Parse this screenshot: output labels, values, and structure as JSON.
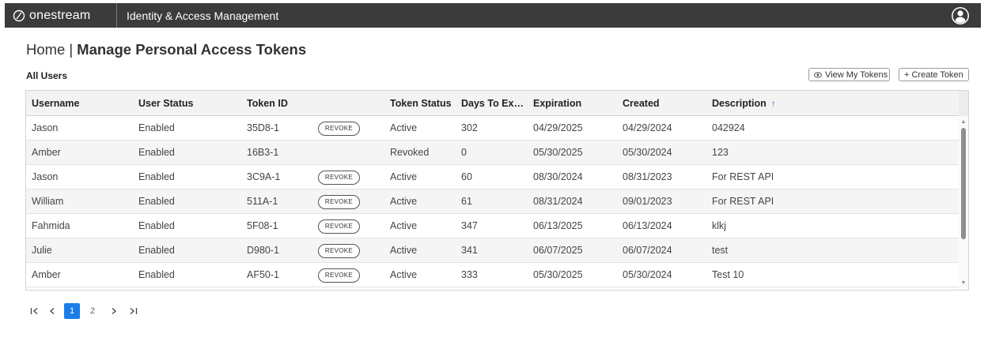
{
  "header": {
    "brand": "onestream",
    "app_title": "Identity & Access Management",
    "brand_icon": "onestream-logo-icon",
    "user_icon": "user-avatar-icon"
  },
  "page": {
    "breadcrumb_home": "Home",
    "breadcrumb_sep": "|",
    "breadcrumb_current": "Manage Personal Access Tokens",
    "section_title": "All Users"
  },
  "toolbar": {
    "view_my_tokens": "View My Tokens",
    "create_token": "+ Create Token"
  },
  "table": {
    "columns": [
      "Username",
      "User Status",
      "Token ID",
      "Token Status",
      "Days To Ex…",
      "Expiration",
      "Created",
      "Description"
    ],
    "sort_indicator": "↑",
    "revoke_label": "REVOKE",
    "rows": [
      {
        "username": "Jason",
        "user_status": "Enabled",
        "token_id": "35D8-1",
        "revoke": true,
        "token_status": "Active",
        "days": "302",
        "expiration": "04/29/2025",
        "created": "04/29/2024",
        "description": "042924"
      },
      {
        "username": "Amber",
        "user_status": "Enabled",
        "token_id": "16B3-1",
        "revoke": false,
        "token_status": "Revoked",
        "days": "0",
        "expiration": "05/30/2025",
        "created": "05/30/2024",
        "description": "123"
      },
      {
        "username": "Jason",
        "user_status": "Enabled",
        "token_id": "3C9A-1",
        "revoke": true,
        "token_status": "Active",
        "days": "60",
        "expiration": "08/30/2024",
        "created": "08/31/2023",
        "description": "For REST API"
      },
      {
        "username": "William",
        "user_status": "Enabled",
        "token_id": "511A-1",
        "revoke": true,
        "token_status": "Active",
        "days": "61",
        "expiration": "08/31/2024",
        "created": "09/01/2023",
        "description": "For REST API"
      },
      {
        "username": "Fahmida",
        "user_status": "Enabled",
        "token_id": "5F08-1",
        "revoke": true,
        "token_status": "Active",
        "days": "347",
        "expiration": "06/13/2025",
        "created": "06/13/2024",
        "description": "klkj"
      },
      {
        "username": "Julie",
        "user_status": "Enabled",
        "token_id": "D980-1",
        "revoke": true,
        "token_status": "Active",
        "days": "341",
        "expiration": "06/07/2025",
        "created": "06/07/2024",
        "description": "test"
      },
      {
        "username": "Amber",
        "user_status": "Enabled",
        "token_id": "AF50-1",
        "revoke": true,
        "token_status": "Active",
        "days": "333",
        "expiration": "05/30/2025",
        "created": "05/30/2024",
        "description": "Test 10"
      }
    ]
  },
  "pager": {
    "first": "|<",
    "prev": "<",
    "pages": [
      "1",
      "2"
    ],
    "current_page": "1",
    "next": ">",
    "last": ">|"
  },
  "colors": {
    "topbar": "#3b3b3b",
    "accent": "#1a7ee8",
    "sort_arrow": "#2d7ad6"
  }
}
